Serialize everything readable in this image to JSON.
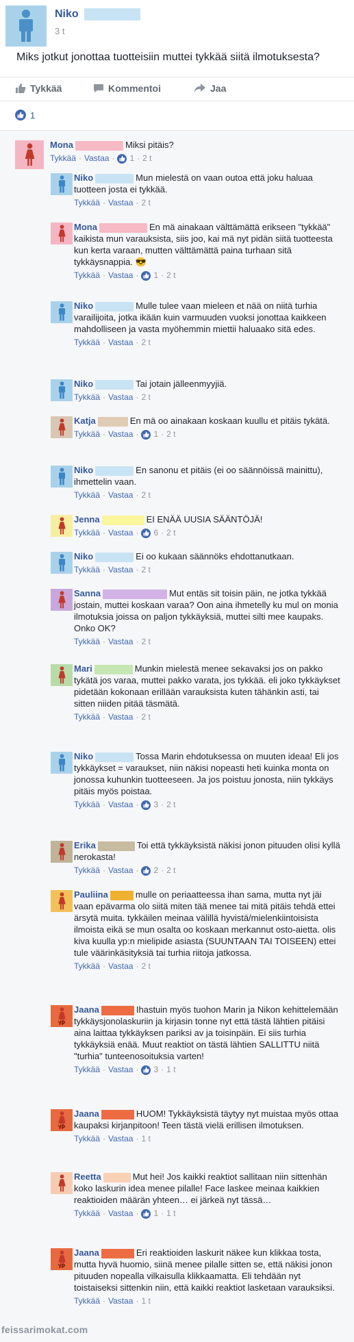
{
  "post": {
    "author": "Niko",
    "time": "3 t",
    "text": "Miks jotkut jonottaa tuotteisiin muttei tykkää siitä ilmotuksesta?",
    "actions": {
      "like": "Tykkää",
      "comment": "Kommentoi",
      "share": "Jaa"
    },
    "like_count": "1"
  },
  "comments": [
    {
      "name": "Mona",
      "text": "Miksi pitäis?",
      "like": "Tykkää",
      "reply": "Vastaa",
      "reactions": "1",
      "time": "2 t",
      "avatar": "female",
      "color": "#f4b6c2",
      "mask": "#f7b9c4",
      "mask_w": 70
    },
    {
      "name": "Niko",
      "text": "Mun mielestä on vaan outoa että joku haluaa tuotteen josta ei tykkää.",
      "like": "Tykkää",
      "reply": "Vastaa",
      "reactions": "",
      "time": "2 t",
      "avatar": "male",
      "color": "#a9d2ea",
      "mask": "#c8e4f4",
      "mask_w": 56
    },
    {
      "name": "Mona",
      "text": "En mä ainakaan välttämättä erikseen \"tykkää\" kaikista mun varauksista, siis joo, kai mä nyt pidän siitä tuotteesta kun kerta varaan, mutten välttämättä paina turhaan sitä tykkäysnappia. 😎",
      "like": "Tykkää",
      "reply": "Vastaa",
      "reactions": "1",
      "time": "2 t",
      "avatar": "female",
      "color": "#f4b6c2",
      "mask": "#f7b9c4",
      "mask_w": 70
    },
    {
      "name": "Niko",
      "text": "Mulle tulee vaan mieleen et nää on niitä turhia varailijoita, jotka ikään kuin varmuuden vuoksi jonottaa kaikkeen mahdolliseen ja vasta myöhemmin miettii haluaako sitä edes.",
      "like": "Tykkää",
      "reply": "Vastaa",
      "reactions": "",
      "time": "2 t",
      "avatar": "male",
      "color": "#a9d2ea",
      "mask": "#c8e4f4",
      "mask_w": 56
    },
    {
      "name": "Niko",
      "text": "Tai jotain jälleenmyyjiä.",
      "like": "Tykkää",
      "reply": "Vastaa",
      "reactions": "",
      "time": "2 t",
      "avatar": "male",
      "color": "#a9d2ea",
      "mask": "#c8e4f4",
      "mask_w": 56
    },
    {
      "name": "Katja",
      "text": "En mä oo ainakaan koskaan kuullu et pitäis tykätä.",
      "like": "Tykkää",
      "reply": "Vastaa",
      "reactions": "1",
      "time": "2 t",
      "avatar": "female",
      "color": "#d8c7b4",
      "mask": "#e0cbb4",
      "mask_w": 44
    },
    {
      "name": "Niko",
      "text": "En sanonu et pitäis (ei oo säännöissä mainittu), ihmettelin vaan.",
      "like": "Tykkää",
      "reply": "Vastaa",
      "reactions": "",
      "time": "2 t",
      "avatar": "male",
      "color": "#a9d2ea",
      "mask": "#c8e4f4",
      "mask_w": 56
    },
    {
      "name": "Jenna",
      "text": "EI ENÄÄ UUSIA SÄÄNTÖJÄ!",
      "like": "Tykkää",
      "reply": "Vastaa",
      "reactions": "6",
      "time": "2 t",
      "avatar": "female",
      "color": "#f7efa0",
      "mask": "#fbf59c",
      "mask_w": 62
    },
    {
      "name": "Niko",
      "text": "Ei oo kukaan säännöks ehdottanutkaan.",
      "like": "Tykkää",
      "reply": "Vastaa",
      "reactions": "",
      "time": "2 t",
      "avatar": "male",
      "color": "#a9d2ea",
      "mask": "#c8e4f4",
      "mask_w": 56
    },
    {
      "name": "Sanna",
      "text": "Mut entäs sit toisin päin, ne jotka tykkää jostain, muttei koskaan varaa? Oon aina ihmetelly ku mul on monia ilmotuksia joissa on paljon tykkäyksiä, muttei silti mee kaupaks. Onko OK?",
      "like": "Tykkää",
      "reply": "Vastaa",
      "reactions": "",
      "time": "2 t",
      "avatar": "female",
      "color": "#c8a8dc",
      "mask": "#d3b3e6",
      "mask_w": 94
    },
    {
      "name": "Mari",
      "text": "Munkin mielestä menee sekavaksi jos on pakko tykätä jos varaa, muttei pakko varata, jos tykkää. eli joko tykkäykset pidetään kokonaan erillään varauksista kuten tähänkin asti, tai sitten niiden pitää täsmätä.",
      "like": "Tykkää",
      "reply": "Vastaa",
      "reactions": "",
      "time": "2 t",
      "avatar": "female",
      "color": "#b8dca8",
      "mask": "#c6e6b4",
      "mask_w": 56
    },
    {
      "name": "Niko",
      "text": "Tossa Marin ehdotuksessa on muuten ideaa! Eli jos tykkäykset = varaukset, niin näkisi nopeasti heti kuinka monta on jonossa kuhunkin tuotteeseen. Ja jos poistuu jonosta, niin tykkäys pitäis myös poistaa.",
      "like": "Tykkää",
      "reply": "Vastaa",
      "reactions": "3",
      "time": "2 t",
      "avatar": "male",
      "color": "#a9d2ea",
      "mask": "#c8e4f4",
      "mask_w": 56
    },
    {
      "name": "Erika",
      "text": "Toi että tykkäyksistä näkisi jonon pituuden olisi kyllä nerokasta!",
      "like": "Tykkää",
      "reply": "Vastaa",
      "reactions": "2",
      "time": "2 t",
      "avatar": "female",
      "color": "#bfb398",
      "mask": "#c7bba0",
      "mask_w": 54
    },
    {
      "name": "Pauliina",
      "text": "mulle on periaatteessa ihan sama, mutta nyt jäi vaan epävarma olo siitä miten tää menee tai mitä pitäis tehdä ettei ärsytä muita. tykkäilen meinaa välillä hyvistä/mielenkiintoisista ilmoista eikä se mun osalta oo koskaan merkannut osto-aietta. olis kiva kuulla yp:n mielipide asiasta (SUUNTAAN TAI TOISEEN) ettei tule väärinkäsityksiä tai turhia riitoja jatkossa.",
      "like": "Tykkää",
      "reply": "Vastaa",
      "reactions": "",
      "time": "2 t",
      "avatar": "female",
      "color": "#f3c15a",
      "mask": "#f0b130",
      "mask_w": 34
    },
    {
      "name": "Jaana",
      "text": "Ihastuin myös tuohon Marin ja Nikon kehittelemään tykkäysjonolaskuriin ja kirjasin tonne nyt että tästä lähtien pitäisi aina laittaa tykkäyksen pariksi av ja toisinpäin. Ei siis turhia tykkäyksiä enää. Muut reaktiot on tästä lähtien SALLITTU niitä \"turhia\" tunteenosoituksia varten!",
      "like": "Tykkää",
      "reply": "Vastaa",
      "reactions": "3",
      "time": "1 t",
      "avatar": "yp",
      "color": "#e8693e",
      "mask": "#ee6c44",
      "mask_w": 48
    },
    {
      "name": "Jaana",
      "text": "HUOM! Tykkäyksistä täytyy nyt muistaa myös ottaa kaupaksi kirjanpitoon! Teen tästä vielä erillisen ilmotuksen.",
      "like": "Tykkää",
      "reply": "Vastaa",
      "reactions": "",
      "time": "1 t",
      "avatar": "yp",
      "color": "#e8693e",
      "mask": "#ee6c44",
      "mask_w": 48
    },
    {
      "name": "Reetta",
      "text": "Mut hei! Jos kaikki reaktiot sallitaan niin sittenhän koko laskurin idea menee pilalle! Face laskee meinaa kaikkien reaktioiden määrän yhteen… ei järkeä nyt tässä…",
      "like": "Tykkää",
      "reply": "Vastaa",
      "reactions": "1",
      "time": "1 t",
      "avatar": "female",
      "color": "#f6cdb2",
      "mask": "#fbd1b5",
      "mask_w": 40
    },
    {
      "name": "Jaana",
      "text": "Eri reaktioiden laskurit näkee kun klikkaa tosta, mutta hyvä huomio, siinä menee pilalle sitten se, että näkisi jonon pituuden nopealla vilkaisulla klikkaamatta. Eli tehdään nyt toistaiseksi sittenkin niin, että kaikki reaktiot lasketaan varauksiksi.",
      "like": "Tykkää",
      "reply": "Vastaa",
      "reactions": "",
      "time": "1 t",
      "avatar": "yp",
      "color": "#e8693e",
      "mask": "#ee6c44",
      "mask_w": 48
    }
  ],
  "watermark": "feissarimokat.com",
  "colors": {
    "link": "#365899",
    "meta": "#90949c",
    "like_blue": "#4267b2"
  }
}
